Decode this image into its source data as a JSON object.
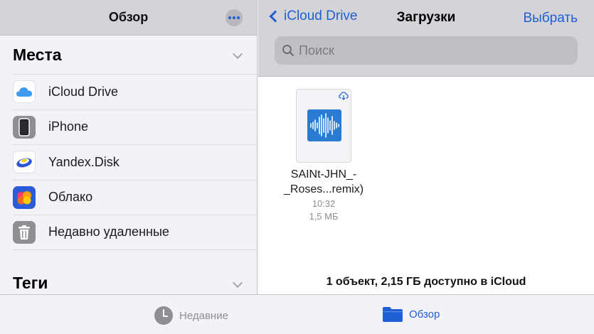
{
  "sidebar": {
    "title": "Обзор",
    "places_title": "Места",
    "tags_title": "Теги",
    "locations": [
      {
        "label": "iCloud Drive",
        "icon": "icloud-icon"
      },
      {
        "label": "iPhone",
        "icon": "iphone-icon"
      },
      {
        "label": "Yandex.Disk",
        "icon": "yandex-disk-icon"
      },
      {
        "label": "Облако",
        "icon": "oblako-icon"
      },
      {
        "label": "Недавно удаленные",
        "icon": "trash-icon"
      }
    ]
  },
  "main": {
    "back_label": "iCloud Drive",
    "title": "Загрузки",
    "select_label": "Выбрать",
    "search_placeholder": "Поиск",
    "files": [
      {
        "name_line1": "SAINt-JHN_-",
        "name_line2": "_Roses...remix)",
        "time": "10:32",
        "size": "1,5 МБ"
      }
    ],
    "status": "1 объект, 2,15 ГБ доступно в iCloud"
  },
  "tabbar": {
    "recent_label": "Недавние",
    "browse_label": "Обзор"
  },
  "colors": {
    "accent": "#1e5fd6",
    "header_bg": "#d4d4d8",
    "audio_file": "#2b7bd2"
  }
}
